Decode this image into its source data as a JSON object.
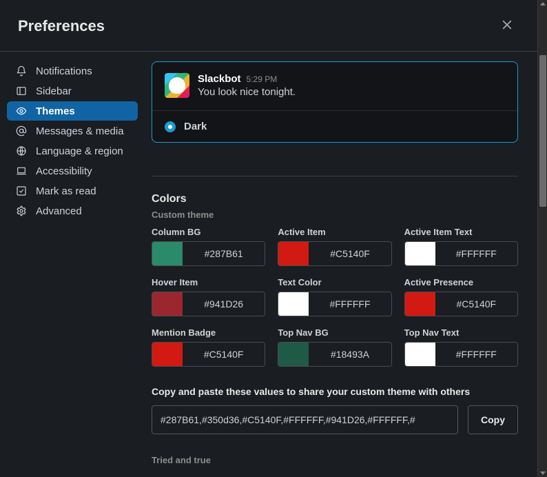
{
  "header": {
    "title": "Preferences"
  },
  "sidebar": {
    "items": [
      {
        "label": "Notifications"
      },
      {
        "label": "Sidebar"
      },
      {
        "label": "Themes"
      },
      {
        "label": "Messages & media"
      },
      {
        "label": "Language & region"
      },
      {
        "label": "Accessibility"
      },
      {
        "label": "Mark as read"
      },
      {
        "label": "Advanced"
      }
    ],
    "activeIndex": 2
  },
  "preview": {
    "name": "Slackbot",
    "time": "5:29 PM",
    "text": "You look nice tonight.",
    "option": "Dark"
  },
  "colors": {
    "title": "Colors",
    "subtitle": "Custom theme",
    "swatches": [
      {
        "label": "Column BG",
        "hex": "#287B61",
        "chip": "#2a8a6a"
      },
      {
        "label": "Active Item",
        "hex": "#C5140F",
        "chip": "#d21a12"
      },
      {
        "label": "Active Item Text",
        "hex": "#FFFFFF",
        "chip": "#ffffff"
      },
      {
        "label": "Hover Item",
        "hex": "#941D26",
        "chip": "#9a2730"
      },
      {
        "label": "Text Color",
        "hex": "#FFFFFF",
        "chip": "#ffffff"
      },
      {
        "label": "Active Presence",
        "hex": "#C5140F",
        "chip": "#d21a12"
      },
      {
        "label": "Mention Badge",
        "hex": "#C5140F",
        "chip": "#d21a12"
      },
      {
        "label": "Top Nav BG",
        "hex": "#18493A",
        "chip": "#1f5a47"
      },
      {
        "label": "Top Nav Text",
        "hex": "#FFFFFF",
        "chip": "#ffffff"
      }
    ]
  },
  "share": {
    "label": "Copy and paste these values to share your custom theme with others",
    "value": "#287B61,#350d36,#C5140F,#FFFFFF,#941D26,#FFFFFF,#",
    "copy_label": "Copy"
  },
  "tried": {
    "label": "Tried and true"
  }
}
